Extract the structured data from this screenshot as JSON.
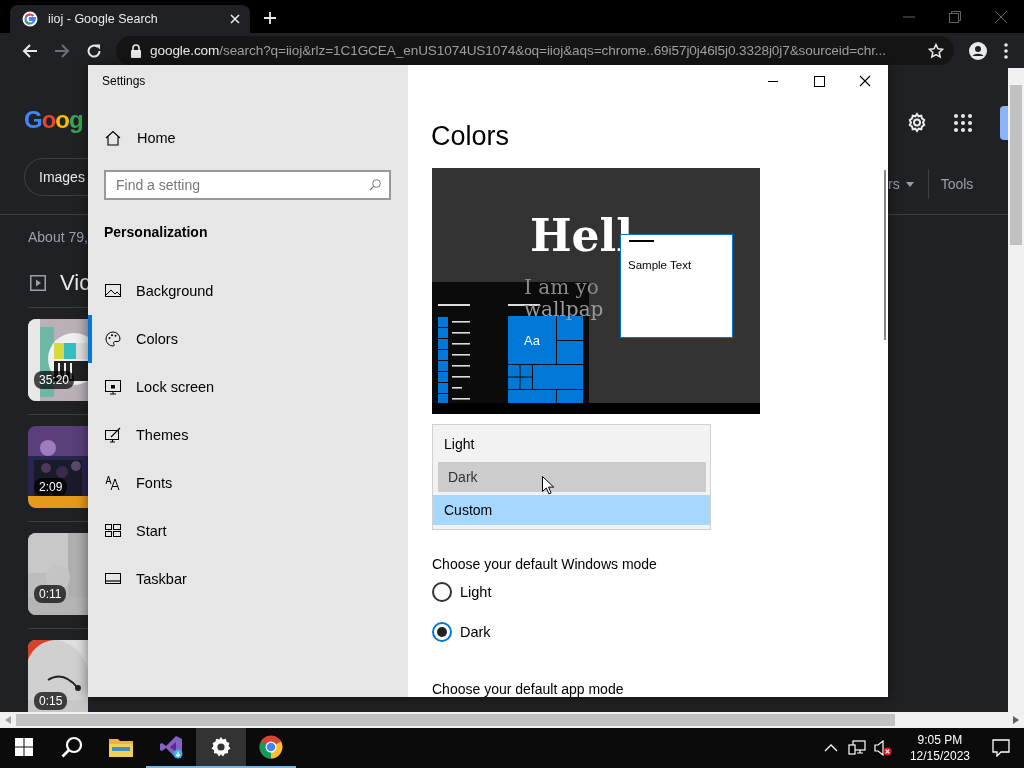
{
  "browser": {
    "tab": {
      "title": "iioj - Google Search"
    },
    "url": {
      "host": "google.com",
      "path": "/search?q=iioj&rlz=1C1GCEA_enUS1074US1074&oq=iioj&aqs=chrome..69i57j0j46l5j0.3328j0j7&sourceid=chr..."
    }
  },
  "search_page": {
    "logo": "Goog",
    "chip": "Images",
    "result_count": "About 79,",
    "section_title": "Vic",
    "videos": [
      {
        "duration": "35:20"
      },
      {
        "duration": "2:09"
      },
      {
        "duration": "0:11"
      },
      {
        "duration": "0:15"
      }
    ],
    "filter_partial": "rs",
    "tools": "Tools"
  },
  "settings": {
    "title": "Settings",
    "home": "Home",
    "search": {
      "placeholder": "Find a setting"
    },
    "category": "Personalization",
    "nav": [
      {
        "label": "Background",
        "selected": false
      },
      {
        "label": "Colors",
        "selected": true
      },
      {
        "label": "Lock screen",
        "selected": false
      },
      {
        "label": "Themes",
        "selected": false
      },
      {
        "label": "Fonts",
        "selected": false
      },
      {
        "label": "Start",
        "selected": false
      },
      {
        "label": "Taskbar",
        "selected": false
      }
    ]
  },
  "colors_page": {
    "heading": "Colors",
    "preview": {
      "headline": "Hell",
      "subline_1": "I am yo",
      "subline_2": "wallpap",
      "tile_label": "Aa",
      "window_text": "Sample Text"
    },
    "dropdown": [
      {
        "label": "Light",
        "hovered": false,
        "selected": false
      },
      {
        "label": "Dark",
        "hovered": true,
        "selected": false
      },
      {
        "label": "Custom",
        "hovered": false,
        "selected": true
      }
    ],
    "windows_mode": {
      "label": "Choose your default Windows mode",
      "options": [
        {
          "label": "Light",
          "selected": false
        },
        {
          "label": "Dark",
          "selected": true
        }
      ]
    },
    "app_mode_label": "Choose your default app mode"
  },
  "taskbar": {
    "apps": [
      {
        "running": false,
        "active": false
      },
      {
        "running": true,
        "active": false
      },
      {
        "running": true,
        "active": true
      },
      {
        "running": true,
        "active": false
      }
    ],
    "clock": {
      "time": "9:05 PM",
      "date": "12/15/2023"
    }
  }
}
